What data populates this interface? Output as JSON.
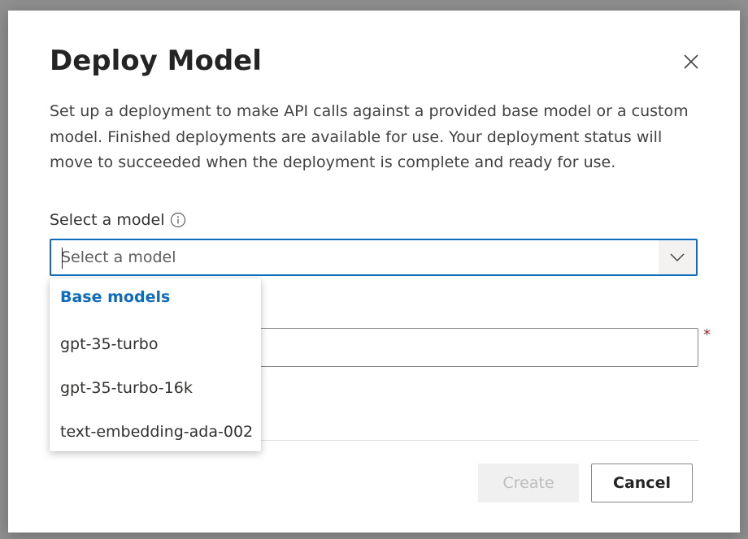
{
  "dialog": {
    "title": "Deploy Model",
    "description": "Set up a deployment to make API calls against a provided base model or a custom model. Finished deployments are available for use. Your deployment status will move to succeeded when the deployment is complete and ready for use.",
    "close_icon": "close-icon"
  },
  "model_select": {
    "label": "Select a model",
    "info_icon": "info-icon",
    "placeholder": "Select a model",
    "value": "",
    "chevron_icon": "chevron-down-icon"
  },
  "dropdown": {
    "group_header": "Base models",
    "options": [
      "gpt-35-turbo",
      "gpt-35-turbo-16k",
      "text-embedding-ada-002"
    ]
  },
  "second_field": {
    "required_marker": "*"
  },
  "footer": {
    "create_label": "Create",
    "cancel_label": "Cancel",
    "create_disabled": true
  },
  "colors": {
    "accent": "#0f6cbd",
    "required": "#a4262c",
    "disabled_bg": "#f0f0f0",
    "disabled_text": "#bdbdbd"
  }
}
